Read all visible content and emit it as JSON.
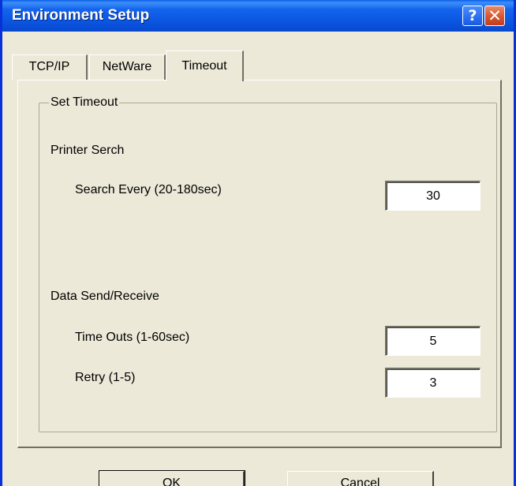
{
  "window": {
    "title": "Environment Setup",
    "help_glyph": "?",
    "close_glyph": "✕"
  },
  "tabs": [
    {
      "label": "TCP/IP",
      "active": false
    },
    {
      "label": "NetWare",
      "active": false
    },
    {
      "label": "Timeout",
      "active": true
    }
  ],
  "timeout_panel": {
    "group_label": "Set Timeout",
    "printer_search": {
      "heading": "Printer Serch",
      "search_every_label": "Search Every (20-180sec)",
      "search_every_value": "30"
    },
    "data_send_receive": {
      "heading": "Data Send/Receive",
      "time_outs_label": "Time Outs (1-60sec)",
      "time_outs_value": "5",
      "retry_label": "Retry (1-5)",
      "retry_value": "3"
    }
  },
  "buttons": {
    "ok_label": "OK",
    "cancel_label": "Cancel"
  },
  "colors": {
    "title_bar": "#0a55e0",
    "dialog_face": "#ece9d8",
    "close_button": "#d8542e"
  },
  "icons": {
    "help": "help-icon",
    "close": "close-icon"
  }
}
